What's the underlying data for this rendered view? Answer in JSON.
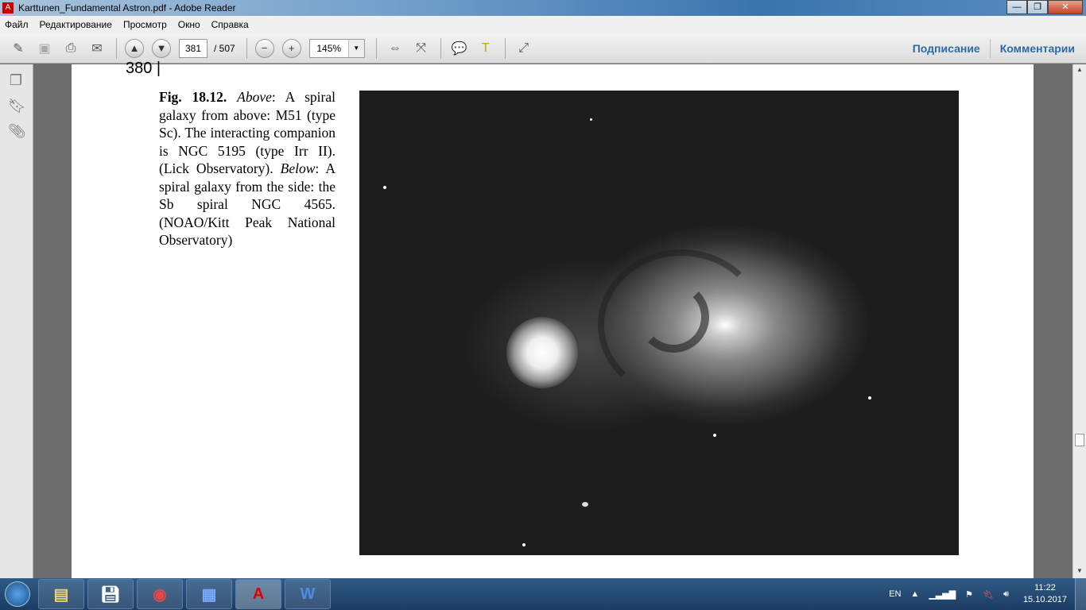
{
  "window": {
    "title": "Karttunen_Fundamental Astron.pdf - Adobe Reader",
    "minimize": "—",
    "maximize": "❐",
    "close": "✕"
  },
  "menu": [
    "Файл",
    "Редактирование",
    "Просмотр",
    "Окно",
    "Справка"
  ],
  "toolbar": {
    "page_current": "381",
    "page_total": "/ 507",
    "zoom": "145%",
    "sign_label": "Подписание",
    "comment_label": "Комментарии"
  },
  "document": {
    "page_number": "380",
    "caption": {
      "fig": "Fig. 18.12.",
      "above_label": "Above",
      "above_text": ": A spiral galaxy from above: M51 (type Sc). The interacting companion is NGC 5195 (type Irr II). (Lick Observatory). ",
      "below_label": "Below",
      "below_text": ": A spiral galaxy from the side: the Sb spiral NGC 4565. (NOAO/Kitt Peak National Observatory)"
    }
  },
  "taskbar": {
    "lang": "EN",
    "time": "11:22",
    "date": "15.10.2017"
  }
}
